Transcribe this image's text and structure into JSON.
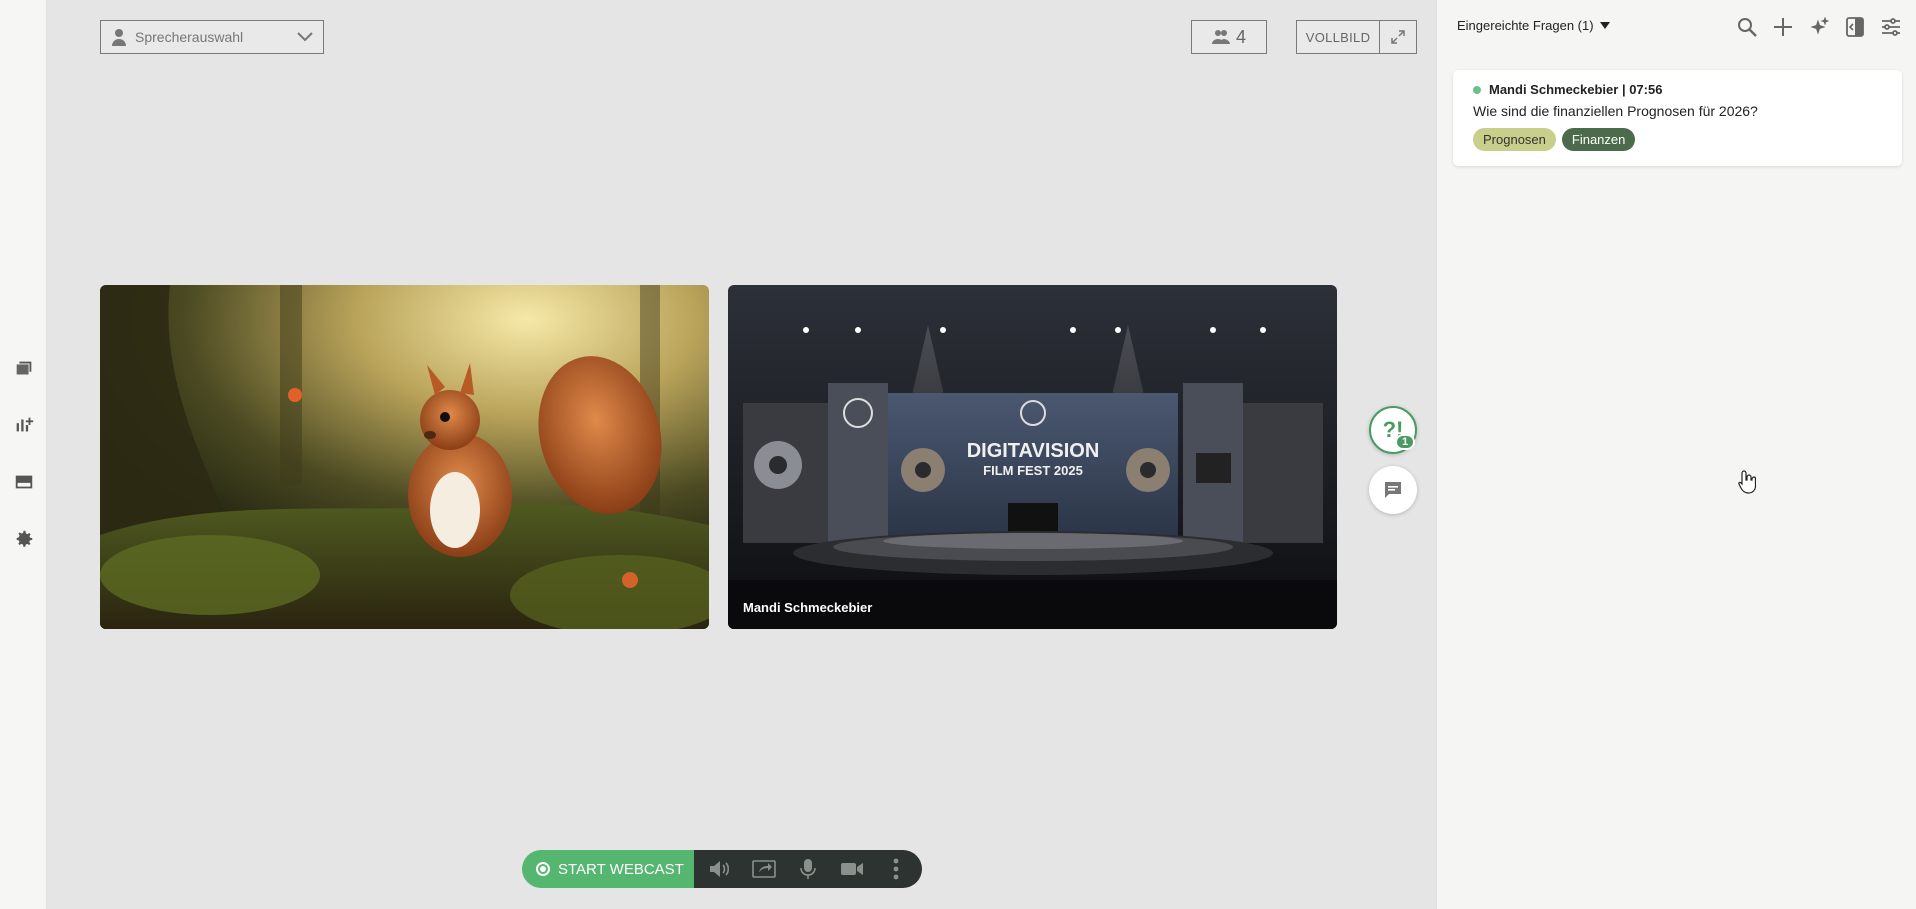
{
  "speaker_select": {
    "placeholder": "Sprecherauswahl"
  },
  "participants": {
    "count": "4"
  },
  "fullscreen": {
    "label": "VOLLBILD"
  },
  "videos": [
    {
      "name": ""
    },
    {
      "name": "Mandi Schmeckebier"
    }
  ],
  "stage_banner": {
    "line1": "DIGITAVISION",
    "line2": "FILM FEST 2025"
  },
  "side_actions": {
    "questions_badge": "1",
    "questions_glyph": "?!"
  },
  "controls": {
    "start_label": "START WEBCAST"
  },
  "panel": {
    "title": "Eingereichte Fragen (1)",
    "questions": [
      {
        "author_time": "Mandi Schmeckebier | 07:56",
        "text": "Wie sind die finanziellen Prognosen für 2026?",
        "tags": [
          "Prognosen",
          "Finanzen"
        ]
      }
    ]
  },
  "colors": {
    "accent": "#55b670",
    "bar": "#2d3330",
    "tag1": "#c8cf8a",
    "tag2": "#4b6b4b"
  }
}
